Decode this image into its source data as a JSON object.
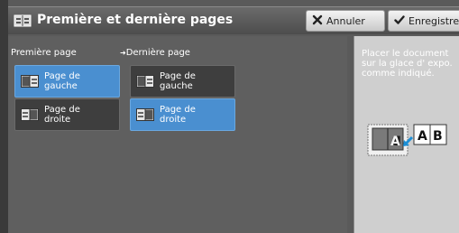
{
  "header": {
    "title": "Première et dernière pages",
    "cancel_label": "Annuler",
    "save_label": "Enregistrer"
  },
  "first_page": {
    "label": "Première page",
    "options": [
      {
        "label_line1": "Page de",
        "label_line2": "gauche",
        "selected": true
      },
      {
        "label_line1": "Page de",
        "label_line2": "droite",
        "selected": false
      }
    ]
  },
  "last_page": {
    "label": "Dernière page",
    "options": [
      {
        "label_line1": "Page de",
        "label_line2": "gauche",
        "selected": false
      },
      {
        "label_line1": "Page de",
        "label_line2": "droite",
        "selected": true
      }
    ]
  },
  "instructions": {
    "line1": "Placer le document",
    "line2": "sur la glace d' expo.",
    "line3": "comme indiqué.",
    "glyph_B": "B",
    "glyph_A": "A"
  },
  "colors": {
    "selected": "#4a8fd0",
    "unselected": "#3e3e3e",
    "panel": "#5f5f5f",
    "instruction_panel": "#cfcfcf"
  }
}
